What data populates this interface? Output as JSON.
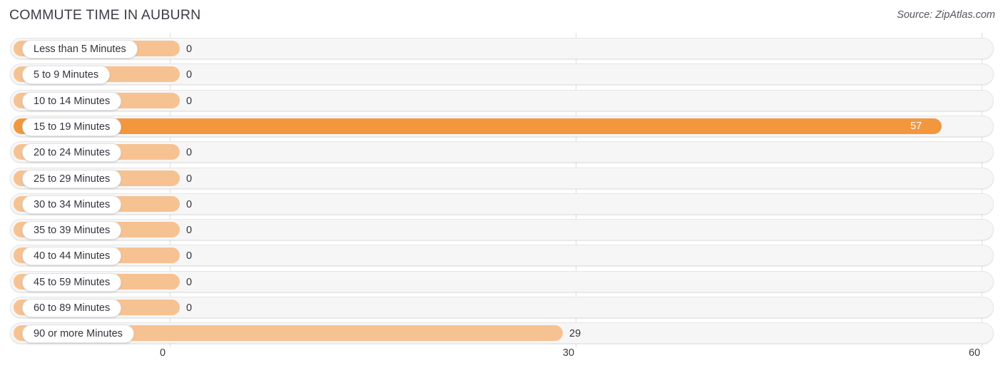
{
  "header": {
    "title": "COMMUTE TIME IN AUBURN",
    "source": "Source: ZipAtlas.com"
  },
  "colors": {
    "bar_light": "#f7c291",
    "bar_dark": "#f3973f",
    "track": "#f6f6f6",
    "gridline": "#dededf",
    "text": "#33333d"
  },
  "chart_data": {
    "type": "bar",
    "orientation": "horizontal",
    "title": "COMMUTE TIME IN AUBURN",
    "xlabel": "",
    "ylabel": "",
    "xlim": [
      0,
      60
    ],
    "xticks": [
      "0",
      "30",
      "60"
    ],
    "grid": true,
    "legend": "none",
    "categories": [
      "Less than 5 Minutes",
      "5 to 9 Minutes",
      "10 to 14 Minutes",
      "15 to 19 Minutes",
      "20 to 24 Minutes",
      "25 to 29 Minutes",
      "30 to 34 Minutes",
      "35 to 39 Minutes",
      "40 to 44 Minutes",
      "45 to 59 Minutes",
      "60 to 89 Minutes",
      "90 or more Minutes"
    ],
    "values": [
      0,
      0,
      0,
      57,
      0,
      0,
      0,
      0,
      0,
      0,
      0,
      29
    ],
    "value_labels": [
      "0",
      "0",
      "0",
      "57",
      "0",
      "0",
      "0",
      "0",
      "0",
      "0",
      "0",
      "29"
    ]
  },
  "rows": [
    {
      "label": "Less than 5 Minutes",
      "value_label": "0",
      "value": 0,
      "highlight": false
    },
    {
      "label": "5 to 9 Minutes",
      "value_label": "0",
      "value": 0,
      "highlight": false
    },
    {
      "label": "10 to 14 Minutes",
      "value_label": "0",
      "value": 0,
      "highlight": false
    },
    {
      "label": "15 to 19 Minutes",
      "value_label": "57",
      "value": 57,
      "highlight": true
    },
    {
      "label": "20 to 24 Minutes",
      "value_label": "0",
      "value": 0,
      "highlight": false
    },
    {
      "label": "25 to 29 Minutes",
      "value_label": "0",
      "value": 0,
      "highlight": false
    },
    {
      "label": "30 to 34 Minutes",
      "value_label": "0",
      "value": 0,
      "highlight": false
    },
    {
      "label": "35 to 39 Minutes",
      "value_label": "0",
      "value": 0,
      "highlight": false
    },
    {
      "label": "40 to 44 Minutes",
      "value_label": "0",
      "value": 0,
      "highlight": false
    },
    {
      "label": "45 to 59 Minutes",
      "value_label": "0",
      "value": 0,
      "highlight": false
    },
    {
      "label": "60 to 89 Minutes",
      "value_label": "0",
      "value": 0,
      "highlight": false
    },
    {
      "label": "90 or more Minutes",
      "value_label": "29",
      "value": 29,
      "highlight": false
    }
  ],
  "axis": {
    "ticks": [
      {
        "label": "0",
        "value": 0
      },
      {
        "label": "30",
        "value": 30
      },
      {
        "label": "60",
        "value": 60
      }
    ]
  }
}
